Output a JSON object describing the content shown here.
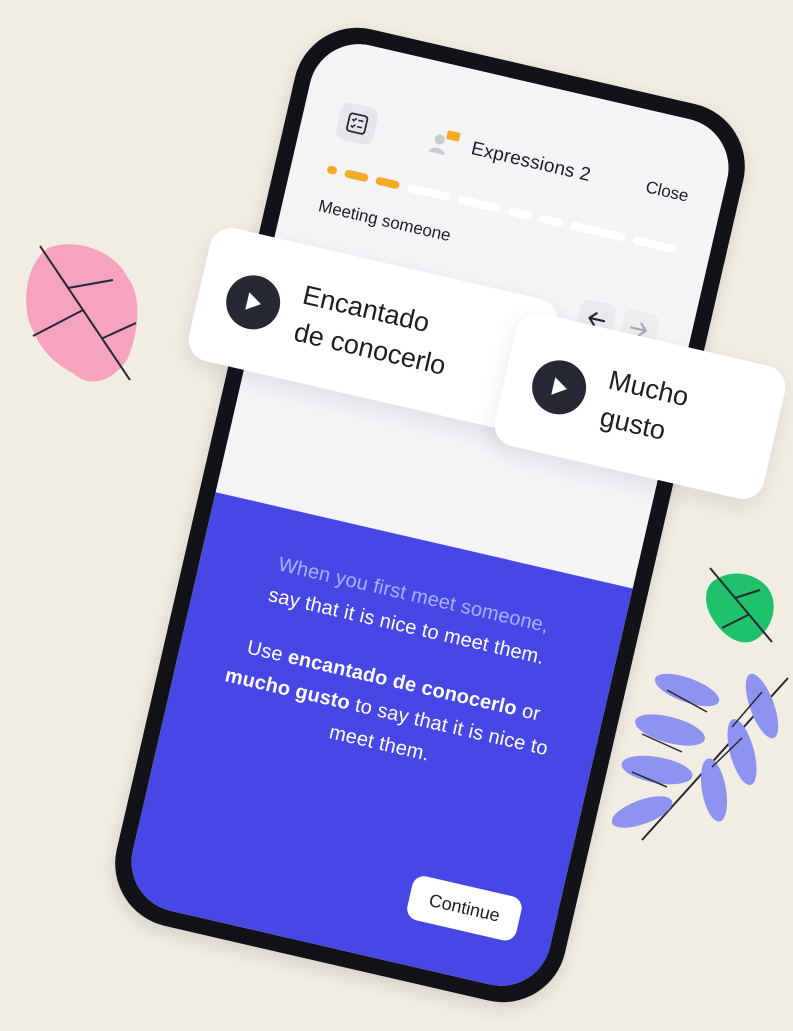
{
  "header": {
    "lesson_title": "Expressions 2",
    "close_label": "Close"
  },
  "progress": {
    "segments_total": 9,
    "segments_completed": 3
  },
  "section": {
    "title": "Meeting someone"
  },
  "navigation": {
    "back_icon": "arrow-left-icon",
    "forward_icon": "arrow-right-icon",
    "forward_enabled": false
  },
  "phrases": [
    {
      "text_line1": "Encantado",
      "text_line2": "de conocerlo"
    },
    {
      "text_line1": "Mucho",
      "text_line2": "gusto"
    }
  ],
  "explanation": {
    "para1_line1": "When you first meet someone,",
    "para1_line2": "say that it is nice to meet them.",
    "para2_prefix": "Use ",
    "para2_bold1": "encantado de conocerlo",
    "para2_mid": " or ",
    "para2_bold2": "mucho gusto",
    "para2_suffix": " to say that it is nice to meet them."
  },
  "footer": {
    "continue_label": "Continue"
  },
  "colors": {
    "background": "#f1ede3",
    "accent_blue": "#4747e6",
    "progress_orange": "#f4aa24",
    "phone_frame": "#121219",
    "leaf_pink": "#f5a3bf",
    "leaf_green": "#1fc26b",
    "leaf_blue": "#8e93f0"
  }
}
